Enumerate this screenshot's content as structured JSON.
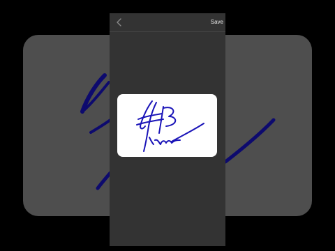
{
  "toolbar": {
    "save_label": "Save",
    "back_icon": "chevron-left-icon"
  },
  "signature": {
    "ink_color": "#1a14b8",
    "background_color": "#ffffff"
  },
  "colors": {
    "panel_background": "#333333",
    "backdrop": "#4e4e4e",
    "page_background": "#000000"
  }
}
